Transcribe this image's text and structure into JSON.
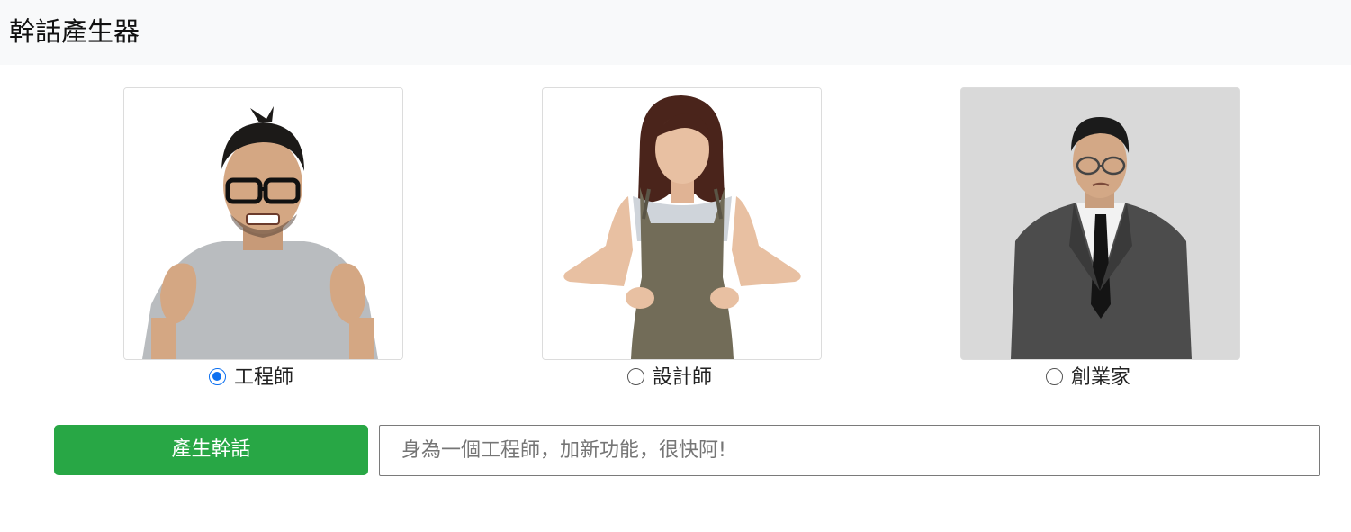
{
  "navbar": {
    "title": "幹話產生器"
  },
  "roles": [
    {
      "label": "工程師",
      "checked": true,
      "image": "frustrated-engineer-photo"
    },
    {
      "label": "設計師",
      "checked": false,
      "image": "annoyed-designer-photo"
    },
    {
      "label": "創業家",
      "checked": false,
      "image": "skeptical-entrepreneur-photo"
    }
  ],
  "generator": {
    "button_label": "產生幹話",
    "result_placeholder": "身為一個工程師，加新功能，很快阿!"
  },
  "colors": {
    "navbar_bg": "#f8f9fa",
    "button_bg": "#28a745",
    "radio_accent": "#0b6ff0"
  }
}
